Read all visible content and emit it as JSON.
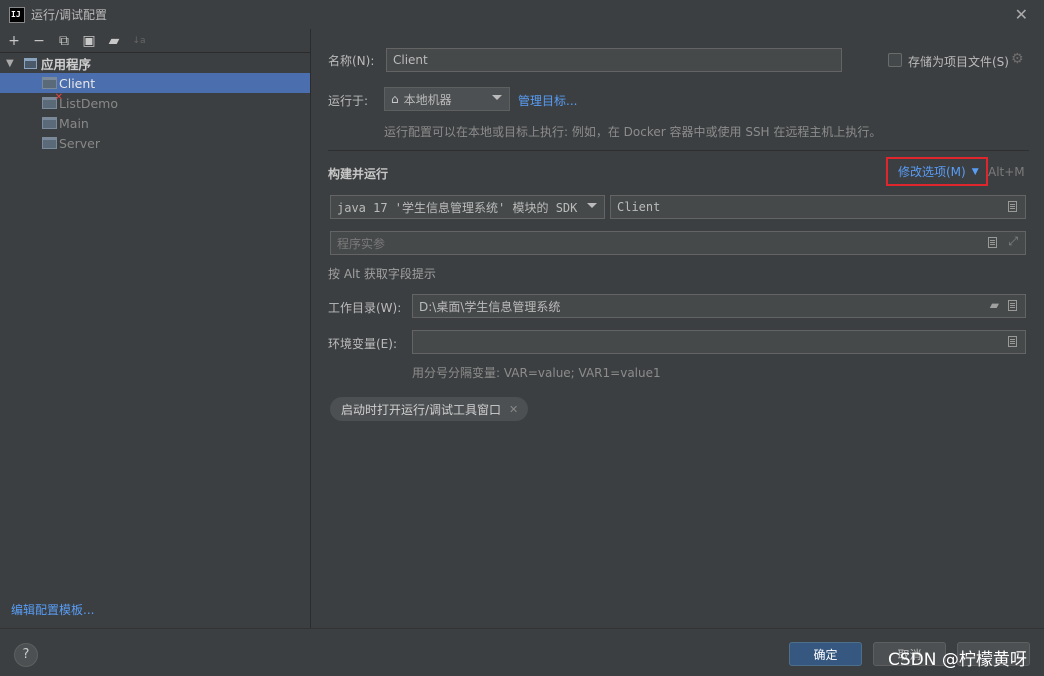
{
  "window": {
    "title": "运行/调试配置",
    "logo": "IJ"
  },
  "toolbar": {
    "icons": [
      "add-icon",
      "remove-icon",
      "copy-icon",
      "save-icon",
      "new-folder-icon",
      "sort-icon"
    ]
  },
  "tree": {
    "group_label": "应用程序",
    "items": [
      {
        "label": "Client",
        "selected": true,
        "error": false
      },
      {
        "label": "ListDemo",
        "selected": false,
        "error": true
      },
      {
        "label": "Main",
        "selected": false,
        "error": false
      },
      {
        "label": "Server",
        "selected": false,
        "error": false
      }
    ]
  },
  "left_footer": {
    "edit_templates": "编辑配置模板..."
  },
  "form": {
    "name_label": "名称(N):",
    "name_value": "Client",
    "store_label": "存储为项目文件(S)",
    "run_on_label": "运行于:",
    "run_on_value": "本地机器",
    "manage_targets": "管理目标...",
    "run_hint": "运行配置可以在本地或目标上执行: 例如，在 Docker 容器中或使用 SSH 在远程主机上执行。",
    "build_title": "构建并运行",
    "modify_options": "修改选项(M)",
    "modify_shortcut": "Alt+M",
    "sdk_value": "java 17 '学生信息管理系统' 模块的 SDK",
    "main_class_value": "Client",
    "program_args_placeholder": "程序实参",
    "alt_hint": "按 Alt 获取字段提示",
    "workdir_label": "工作目录(W):",
    "workdir_value": "D:\\桌面\\学生信息管理系统",
    "env_label": "环境变量(E):",
    "env_value": "",
    "env_hint": "用分号分隔变量: VAR=value; VAR1=value1",
    "chip_label": "启动时打开运行/调试工具窗口"
  },
  "buttons": {
    "ok": "确定",
    "cancel": "取消",
    "help": "?"
  },
  "watermark": "CSDN @柠檬黄呀",
  "colors": {
    "selection": "#4b6eaf",
    "link": "#589df6",
    "highlight_box": "#e0262d",
    "primary_button": "#365880"
  }
}
